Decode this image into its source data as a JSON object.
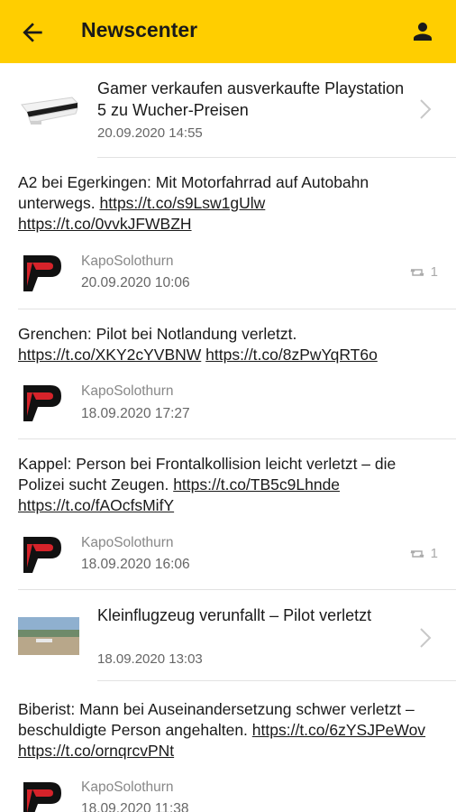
{
  "header": {
    "title": "Newscenter",
    "back_icon": "arrow-left-icon",
    "profile_icon": "person-icon"
  },
  "colors": {
    "accent": "#ffce00",
    "text": "#1a1a1a",
    "muted": "#666666"
  },
  "feed": [
    {
      "kind": "article",
      "headline": "Gamer verkaufen ausverkaufte Playstation 5 zu Wucher-Preisen",
      "date": "20.09.2020 14:55",
      "thumb": "playstation-5-photo"
    },
    {
      "kind": "tweet",
      "text_plain": "A2 bei Egerkingen: Mit Motorfahrrad auf Autobahn unterwegs.",
      "links": [
        "https://t.co/s9Lsw1gUlw",
        "https://t.co/0vvkJFWBZH"
      ],
      "author": "KapoSolothurn",
      "date": "20.09.2020 10:06",
      "retweets": "1"
    },
    {
      "kind": "tweet",
      "text_plain": "Grenchen: Pilot bei Notlandung verletzt.",
      "links": [
        "https://t.co/XKY2cYVBNW",
        "https://t.co/8zPwYqRT6o"
      ],
      "author": "KapoSolothurn",
      "date": "18.09.2020 17:27"
    },
    {
      "kind": "tweet",
      "text_plain": "Kappel: Person bei Frontalkollision leicht verletzt – die Polizei sucht Zeugen.",
      "links": [
        "https://t.co/TB5c9Lhnde",
        "https://t.co/fAOcfsMifY"
      ],
      "author": "KapoSolothurn",
      "date": "18.09.2020 16:06",
      "retweets": "1"
    },
    {
      "kind": "article",
      "headline": "Kleinflugzeug verunfallt – Pilot verletzt",
      "date": "18.09.2020 13:03",
      "thumb": "field-photo"
    },
    {
      "kind": "tweet",
      "text_plain": "Biberist: Mann bei Auseinandersetzung schwer verletzt – beschuldigte Person angehalten.",
      "links": [
        "https://t.co/6zYSJPeWov",
        "https://t.co/ornqrcvPNt"
      ],
      "author": "KapoSolothurn",
      "date": "18.09.2020 11:38"
    }
  ]
}
